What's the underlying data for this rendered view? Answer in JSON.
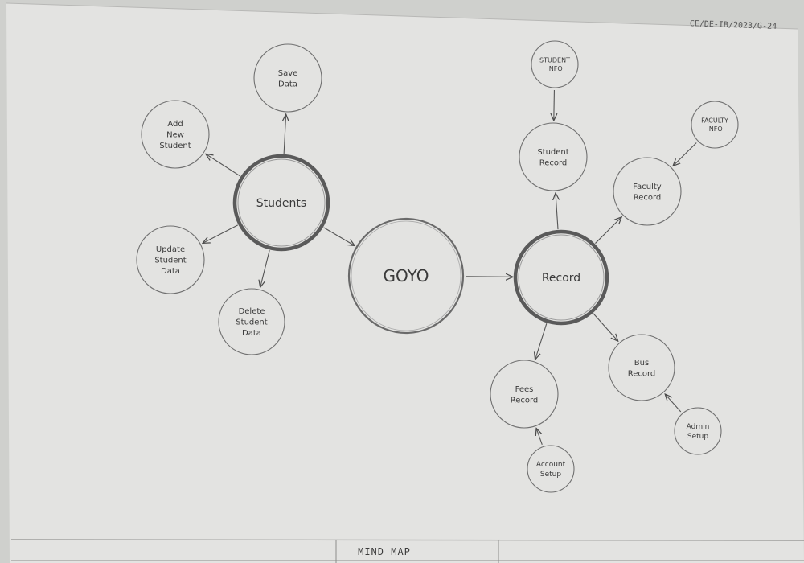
{
  "sheet": {
    "reference": "CE/DE-IB/2023/G-24",
    "footer_title": "MIND MAP"
  },
  "nodes": {
    "center": {
      "lines": [
        "GOYO"
      ]
    },
    "students": {
      "lines": [
        "Students"
      ]
    },
    "record": {
      "lines": [
        "Record"
      ]
    },
    "save_data": {
      "lines": [
        "Save",
        "Data"
      ]
    },
    "add_new_student": {
      "lines": [
        "Add",
        "New",
        "Student"
      ]
    },
    "update_student_data": {
      "lines": [
        "Update",
        "Student",
        "Data"
      ]
    },
    "delete_student_data": {
      "lines": [
        "Delete",
        "Student",
        "Data"
      ]
    },
    "student_info": {
      "lines": [
        "STUDENT",
        "INFO"
      ]
    },
    "student_record": {
      "lines": [
        "Student",
        "Record"
      ]
    },
    "faculty_info": {
      "lines": [
        "FACULTY",
        "INFO"
      ]
    },
    "faculty_record": {
      "lines": [
        "Faculty",
        "Record"
      ]
    },
    "bus_record": {
      "lines": [
        "Bus",
        "Record"
      ]
    },
    "admin_setup": {
      "lines": [
        "Admin",
        "Setup"
      ]
    },
    "fees_record": {
      "lines": [
        "Fees",
        "Record"
      ]
    },
    "account_setup": {
      "lines": [
        "Account",
        "Setup"
      ]
    }
  },
  "edges": [
    {
      "from": "students",
      "to": "center"
    },
    {
      "from": "center",
      "to": "record"
    },
    {
      "from": "students",
      "to": "save_data"
    },
    {
      "from": "students",
      "to": "add_new_student"
    },
    {
      "from": "students",
      "to": "update_student_data"
    },
    {
      "from": "students",
      "to": "delete_student_data"
    },
    {
      "from": "student_info",
      "to": "student_record"
    },
    {
      "from": "record",
      "to": "student_record"
    },
    {
      "from": "faculty_info",
      "to": "faculty_record"
    },
    {
      "from": "record",
      "to": "faculty_record"
    },
    {
      "from": "record",
      "to": "bus_record"
    },
    {
      "from": "admin_setup",
      "to": "bus_record"
    },
    {
      "from": "record",
      "to": "fees_record"
    },
    {
      "from": "account_setup",
      "to": "fees_record"
    }
  ]
}
